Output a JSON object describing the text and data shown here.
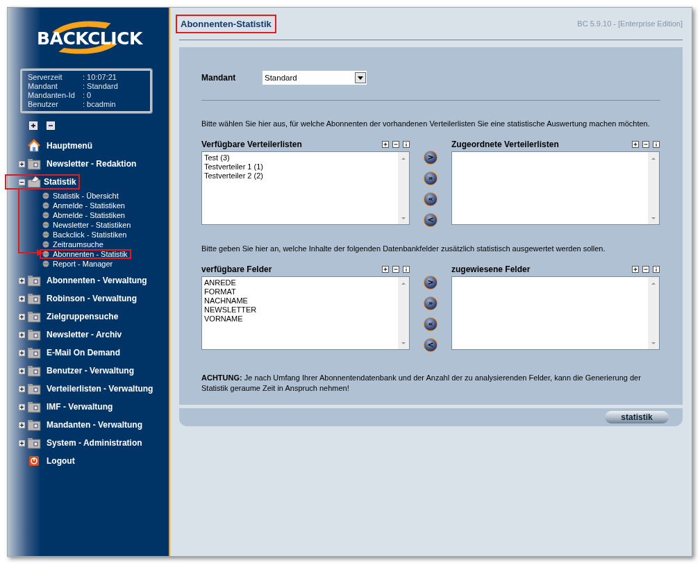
{
  "logo": {
    "text": "BACKCLICK"
  },
  "server_info": [
    {
      "label": "Serverzeit",
      "value": ": 10:07:21"
    },
    {
      "label": "Mandant",
      "value": ": Standard"
    },
    {
      "label": "Mandanten-Id",
      "value": ": 0"
    },
    {
      "label": "Benutzer",
      "value": ": bcadmin"
    }
  ],
  "nav": [
    {
      "label": "Hauptmenü",
      "kind": "home",
      "highlighted": false
    },
    {
      "label": "Newsletter - Redaktion",
      "kind": "folder",
      "expanded": false,
      "highlighted": false
    },
    {
      "label": "Statistik",
      "kind": "stats",
      "expanded": true,
      "highlighted": true,
      "children": [
        {
          "label": "Statistik - Übersicht",
          "highlighted": false
        },
        {
          "label": "Anmelde - Statistiken",
          "highlighted": false
        },
        {
          "label": "Abmelde - Statistiken",
          "highlighted": false
        },
        {
          "label": "Newsletter - Statistiken",
          "highlighted": false
        },
        {
          "label": "Backclick - Statistiken",
          "highlighted": false
        },
        {
          "label": "Zeitraumsuche",
          "highlighted": false
        },
        {
          "label": "Abonnenten - Statistik",
          "highlighted": true
        },
        {
          "label": "Report - Manager",
          "highlighted": false
        }
      ]
    },
    {
      "label": "Abonnenten - Verwaltung",
      "kind": "folder",
      "expanded": false,
      "highlighted": false
    },
    {
      "label": "Robinson - Verwaltung",
      "kind": "folder",
      "expanded": false,
      "highlighted": false
    },
    {
      "label": "Zielgruppensuche",
      "kind": "folder",
      "expanded": false,
      "highlighted": false
    },
    {
      "label": "Newsletter - Archiv",
      "kind": "folder",
      "expanded": false,
      "highlighted": false
    },
    {
      "label": "E-Mail On Demand",
      "kind": "folder",
      "expanded": false,
      "highlighted": false
    },
    {
      "label": "Benutzer - Verwaltung",
      "kind": "folder",
      "expanded": false,
      "highlighted": false
    },
    {
      "label": "Verteilerlisten - Verwaltung",
      "kind": "folder",
      "expanded": false,
      "highlighted": false
    },
    {
      "label": "IMF - Verwaltung",
      "kind": "folder",
      "expanded": false,
      "highlighted": false
    },
    {
      "label": "Mandanten - Verwaltung",
      "kind": "folder",
      "expanded": false,
      "highlighted": false
    },
    {
      "label": "System - Administration",
      "kind": "folder",
      "expanded": false,
      "highlighted": false
    },
    {
      "label": "Logout",
      "kind": "logout",
      "highlighted": false
    }
  ],
  "callout_arrow": true,
  "header": {
    "title": "Abonnenten-Statistik",
    "highlighted": true,
    "version": "BC 5.9.10 - [Enterprise Edition]"
  },
  "mandant": {
    "label": "Mandant",
    "value": "Standard"
  },
  "sections": [
    {
      "hint": "Bitte wählen Sie hier aus, für welche Abonnenten der vorhandenen Verteilerlisten Sie eine statistische Auswertung machen möchten.",
      "left": {
        "title": "Verfügbare Verteilerlisten",
        "items": [
          "Test (3)",
          "Testverteiler 1 (1)",
          "Testverteiler 2 (2)"
        ]
      },
      "right": {
        "title": "Zugeordnete Verteilerlisten"
      },
      "transfer_buttons": [
        ">",
        "»",
        "«",
        "<"
      ]
    },
    {
      "hint": "Bitte geben Sie hier an, welche Inhalte der folgenden Datenbankfelder zusätzlich statistisch ausgewertet werden sollen.",
      "left": {
        "title": "verfügbare Felder",
        "items": [
          "ANREDE",
          "FORMAT",
          "NACHNAME",
          "NEWSLETTER",
          "VORNAME"
        ]
      },
      "right": {
        "title": "zugewiesene Felder"
      },
      "transfer_buttons": [
        ">",
        "»",
        "«",
        "<"
      ]
    }
  ],
  "warning": "**ACHTUNG:** Je nach Umfang Ihrer Abonnentendatenbank und der Anzahl der zu analysierenden Felder, kann die Generierung der Statistik geraume Zeit in Anspruch nehmen!",
  "submit_button": "statistik"
}
